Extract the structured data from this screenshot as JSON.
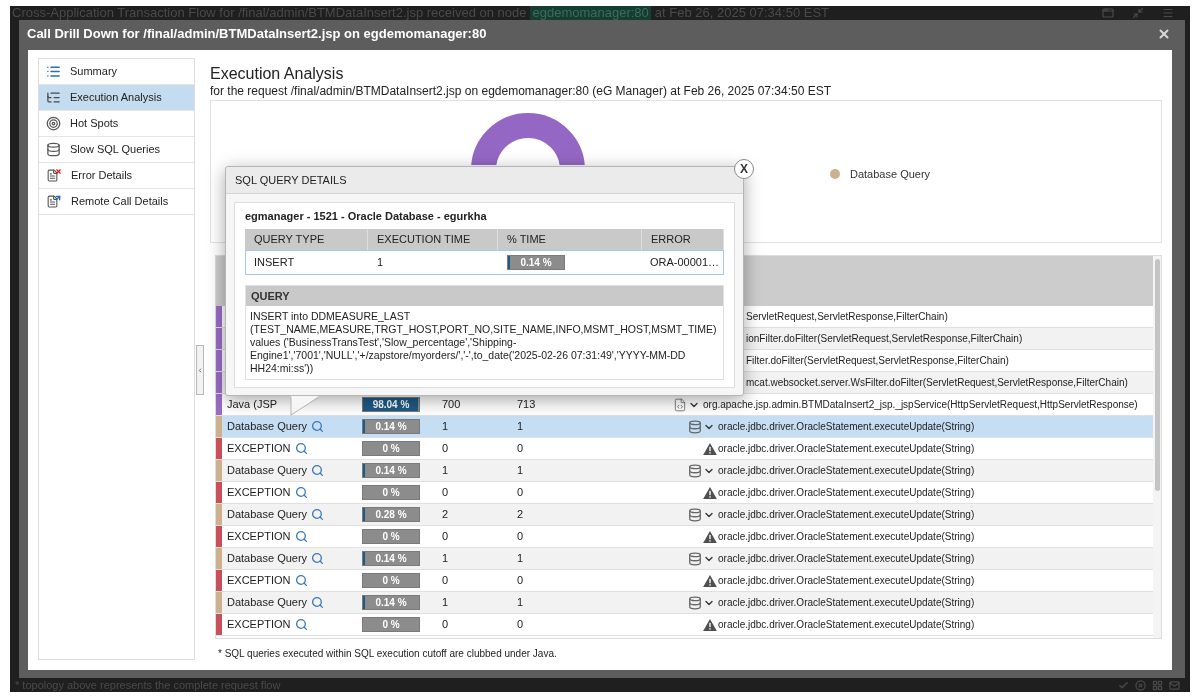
{
  "background": {
    "title_start": "Cross-Application Transaction Flow for /final/admin/BTMDataInsert2.jsp received on node",
    "node": "egdemomanager:80",
    "title_end": "at Feb 26, 2025 07:34:50 EST",
    "note": "* topology above represents the complete request flow"
  },
  "dialog": {
    "title": "Call Drill Down for /final/admin/BTMDataInsert2.jsp on egdemomanager:80"
  },
  "sidebar": {
    "items": [
      {
        "label": "Summary",
        "selected": false
      },
      {
        "label": "Execution Analysis",
        "selected": true
      },
      {
        "label": "Hot Spots",
        "selected": false
      },
      {
        "label": "Slow SQL Queries",
        "selected": false
      },
      {
        "label": "Error Details",
        "selected": false
      },
      {
        "label": "Remote Call Details",
        "selected": false
      }
    ]
  },
  "analysis": {
    "title": "Execution Analysis",
    "subtitle": "for the request /final/admin/BTMDataInsert2.jsp on egdemomanager:80 (eG Manager) at Feb 26, 2025 07:34:50 EST",
    "legend": [
      {
        "label": "Database Query",
        "color": "#cdb08e"
      }
    ]
  },
  "calls": {
    "rows": [
      {
        "kind": "covered",
        "method": "ServletRequest,ServletResponse,FilterChain)",
        "color": "#9b6bc7",
        "selected": false
      },
      {
        "kind": "covered",
        "method": "ionFilter.doFilter(ServletRequest,ServletResponse,FilterChain)",
        "color": "#9b6bc7",
        "selected": false
      },
      {
        "kind": "covered",
        "method": "Filter.doFilter(ServletRequest,ServletResponse,FilterChain)",
        "color": "#9b6bc7",
        "selected": false
      },
      {
        "kind": "covered",
        "method": "mcat.websocket.server.WsFilter.doFilter(ServletRequest,ServletResponse,FilterChain)",
        "color": "#9b6bc7",
        "selected": false
      },
      {
        "kind": "java",
        "name": "Java (JSP",
        "time": "98.04 %",
        "level": 0.9804,
        "column_3": "700",
        "column_4": "713",
        "method": "org.apache.jsp.admin.BTMDataInsert2_jsp._jspService(HttpServletRequest,HttpServletResponse)",
        "color": "#9b6bc7",
        "selected": false,
        "expanded": true,
        "children": [
          {
            "kind": "database",
            "name": "Database Query",
            "time": "0.14 %",
            "level": 0.0014,
            "column_3": "1",
            "column_4": "1",
            "method": "oracle.jdbc.driver.OracleStatement.executeUpdate(String)",
            "color": "#cdb08e",
            "selected": true,
            "expanded": true,
            "children": [
              {
                "kind": "exception",
                "name": "EXCEPTION",
                "time": "0 %",
                "level": 0,
                "column_3": "0",
                "column_4": "0",
                "method": "oracle.jdbc.driver.OracleStatement.executeUpdate(String)",
                "color": "#c9505b",
                "selected": false
              }
            ]
          },
          {
            "kind": "database",
            "name": "Database Query",
            "time": "0.14 %",
            "level": 0.0014,
            "column_3": "1",
            "column_4": "1",
            "method": "oracle.jdbc.driver.OracleStatement.executeUpdate(String)",
            "color": "#cdb08e",
            "selected": false,
            "expanded": true,
            "children": [
              {
                "kind": "exception",
                "name": "EXCEPTION",
                "time": "0 %",
                "level": 0,
                "column_3": "0",
                "column_4": "0",
                "method": "oracle.jdbc.driver.OracleStatement.executeUpdate(String)",
                "color": "#c9505b",
                "selected": false
              }
            ]
          },
          {
            "kind": "database",
            "name": "Database Query",
            "time": "0.28 %",
            "level": 0.0028,
            "column_3": "2",
            "column_4": "2",
            "method": "oracle.jdbc.driver.OracleStatement.executeUpdate(String)",
            "color": "#cdb08e",
            "selected": false,
            "expanded": true,
            "children": [
              {
                "kind": "exception",
                "name": "EXCEPTION",
                "time": "0 %",
                "level": 0,
                "column_3": "0",
                "column_4": "0",
                "method": "oracle.jdbc.driver.OracleStatement.executeUpdate(String)",
                "color": "#c9505b",
                "selected": false
              }
            ]
          },
          {
            "kind": "database",
            "name": "Database Query",
            "time": "0.14 %",
            "level": 0.0014,
            "column_3": "1",
            "column_4": "1",
            "method": "oracle.jdbc.driver.OracleStatement.executeUpdate(String)",
            "color": "#cdb08e",
            "selected": false,
            "expanded": true,
            "children": [
              {
                "kind": "exception",
                "name": "EXCEPTION",
                "time": "0 %",
                "level": 0,
                "column_3": "0",
                "column_4": "0",
                "method": "oracle.jdbc.driver.OracleStatement.executeUpdate(String)",
                "color": "#c9505b",
                "selected": false
              }
            ]
          },
          {
            "kind": "database",
            "name": "Database Query",
            "time": "0.14 %",
            "level": 0.0014,
            "column_3": "1",
            "column_4": "1",
            "method": "oracle.jdbc.driver.OracleStatement.executeUpdate(String)",
            "color": "#cdb08e",
            "selected": false,
            "expanded": true,
            "children": [
              {
                "kind": "exception",
                "name": "EXCEPTION",
                "time": "0 %",
                "level": 0,
                "column_3": "0",
                "column_4": "0",
                "method": "oracle.jdbc.driver.OracleStatement.executeUpdate(String)",
                "color": "#c9505b",
                "selected": false
              }
            ]
          }
        ]
      }
    ],
    "footnote": "* SQL queries executed within SQL execution cutoff are clubbed under Java."
  },
  "sql_details": {
    "title": "SQL QUERY DETAILS",
    "source": "egmanager - 1521 - Oracle Database - egurkha",
    "columns": [
      "QUERY TYPE",
      "EXECUTION TIME",
      "% TIME",
      "ERROR"
    ],
    "row": {
      "query_type": "INSERT",
      "execution_time": "1",
      "time": "0.14 %",
      "level": 0.0014,
      "error": "ORA-00001…"
    },
    "query_label": "QUERY",
    "query": "INSERT into DDMEASURE_LAST (TEST_NAME,MEASURE,TRGT_HOST,PORT_NO,SITE_NAME,INFO,MSMT_HOST,MSMT_TIME) values ('BusinessTransTest','Slow_percentage','Shipping-Engine1','7001','NULL','+/zapstore/myorders/','-',to_date('2025-02-26 07:31:49','YYYY-MM-DD HH24:mi:ss'))",
    "close": "X"
  }
}
